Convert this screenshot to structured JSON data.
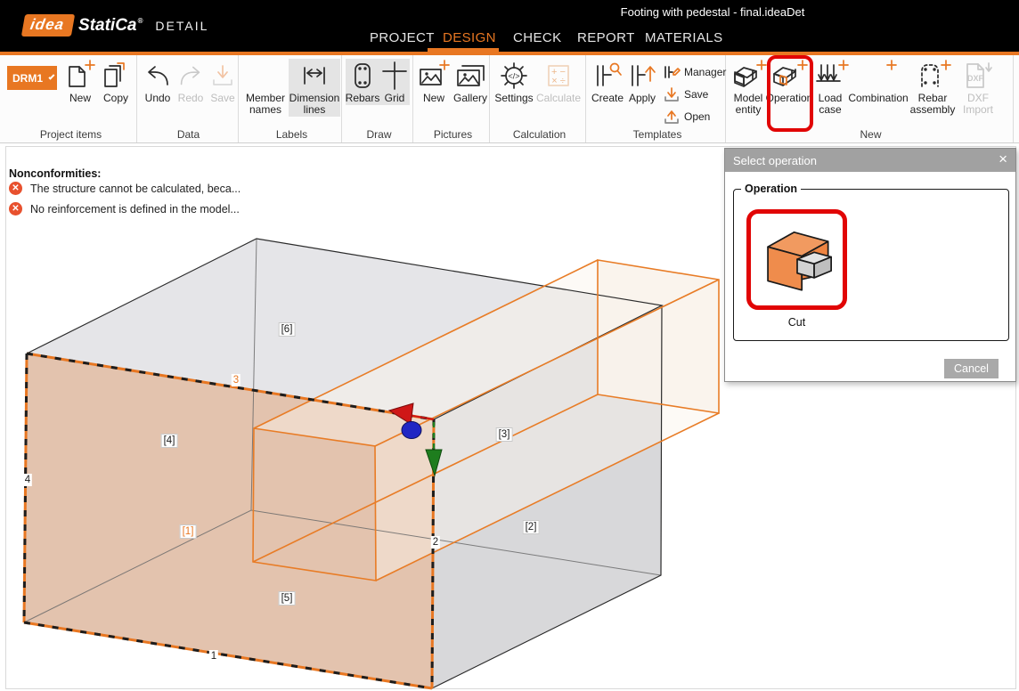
{
  "titlebar": {
    "logo_idea": "idea",
    "logo_statica": "StatiCa",
    "logo_registered": "®",
    "module": "DETAIL",
    "document_title": "Footing with pedestal - final.ideaDet"
  },
  "menu": {
    "project": "PROJECT",
    "design": "DESIGN",
    "check": "CHECK",
    "report": "REPORT",
    "materials": "MATERIALS"
  },
  "ribbon": {
    "project_items": {
      "caption": "Project items",
      "drm1_label": "DRM1",
      "new_label": "New",
      "copy_label": "Copy"
    },
    "data_group": {
      "caption": "Data",
      "undo_label": "Undo",
      "redo_label": "Redo",
      "save_label": "Save"
    },
    "labels_group": {
      "caption": "Labels",
      "member_names_label": "Member names",
      "dimension_lines_label": "Dimension lines"
    },
    "draw_group": {
      "caption": "Draw",
      "rebars_label": "Rebars",
      "grid_label": "Grid"
    },
    "pictures_group": {
      "caption": "Pictures",
      "new_label": "New",
      "gallery_label": "Gallery"
    },
    "calculation_group": {
      "caption": "Calculation",
      "settings_label": "Settings",
      "calculate_label": "Calculate"
    },
    "templates_group": {
      "caption": "Templates",
      "create_label": "Create",
      "apply_label": "Apply",
      "manager_label": "Manager",
      "save_label": "Save",
      "open_label": "Open"
    },
    "new_group": {
      "caption": "New",
      "model_entity_label": "Model entity",
      "operation_label": "Operation",
      "load_case_label": "Load case",
      "combination_label": "Combination",
      "rebar_assembly_label": "Rebar assembly",
      "dxf_import_label": "DXF Import"
    }
  },
  "nonconformities": {
    "title": "Nonconformities:",
    "items": [
      "The structure cannot be calculated, beca...",
      "No reinforcement is defined in the model..."
    ]
  },
  "scene": {
    "face_labels": {
      "f1": "[1]",
      "f2": "[2]",
      "f3": "[3]",
      "f4": "[4]",
      "f5": "[5]",
      "f6": "[6]"
    },
    "edge_labels": {
      "e1": "1",
      "e2": "2",
      "e3": "3",
      "e4": "4"
    }
  },
  "dialog": {
    "title": "Select operation",
    "close": "×",
    "group_label": "Operation",
    "operation_name": "Cut",
    "cancel_label": "Cancel"
  },
  "colors": {
    "accent": "#e87722",
    "highlight_red": "#e10505",
    "alert": "#e8512e",
    "selected_face": "#e3c3ae",
    "cut_fill": "#faf3ec"
  }
}
